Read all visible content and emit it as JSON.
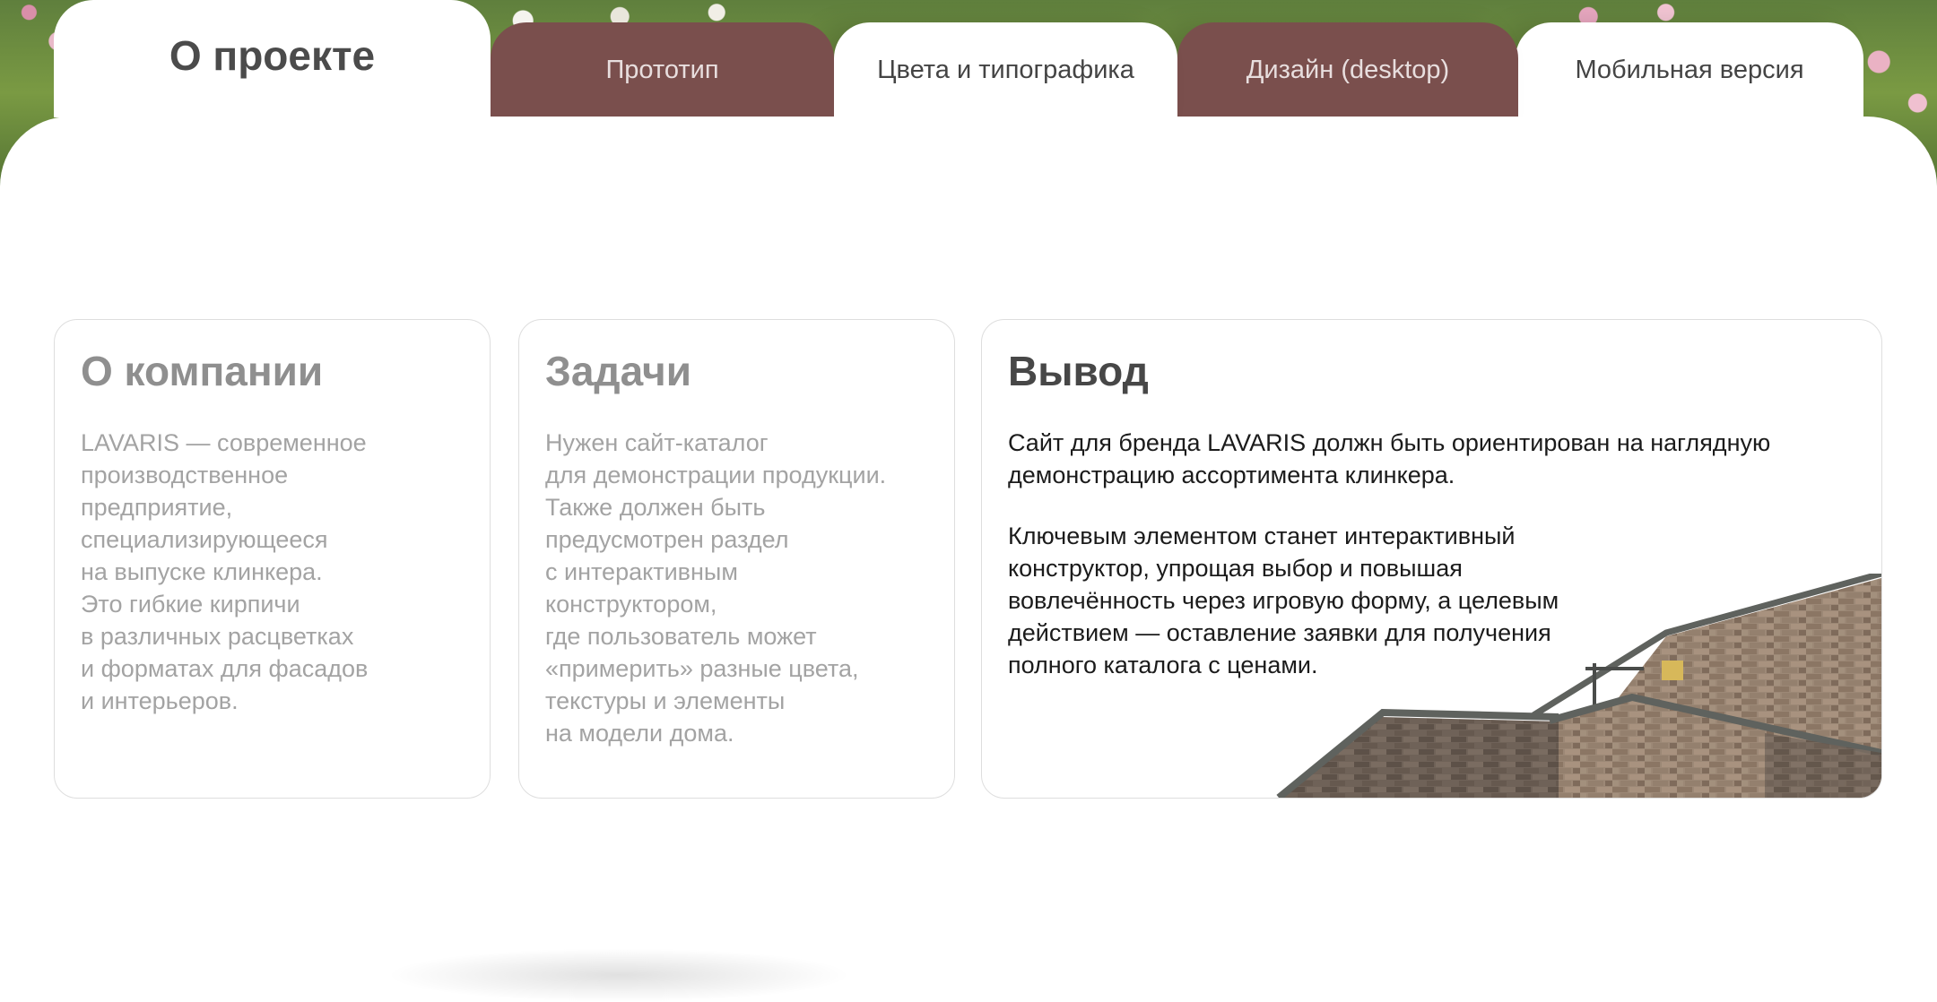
{
  "tabs": [
    {
      "label": "О проекте",
      "active": true
    },
    {
      "label": "Прототип"
    },
    {
      "label": "Цвета и типографика"
    },
    {
      "label": "Дизайн (desktop)"
    },
    {
      "label": "Мобильная версия"
    }
  ],
  "cards": {
    "company": {
      "title": "О компании",
      "text": "LAVARIS — современное\nпроизводственное\nпредприятие,\nспециализирующееся\nна выпуске клинкера.\nЭто гибкие кирпичи\nв различных расцветках\nи форматах для фасадов\nи интерьеров."
    },
    "tasks": {
      "title": "Задачи",
      "text": "Нужен сайт-каталог\nдля демонстрации продукции.\nТакже должен быть\nпредусмотрен раздел\nс интерактивным\nконструктором,\nгде пользователь может\n«примерить» разные цвета,\nтекстуры и элементы\nна модели дома."
    },
    "result": {
      "title": "Вывод",
      "text1": "Сайт для бренда LAVARIS должн быть ориентирован на наглядную\nдемонстрацию ассортимента клинкера.",
      "text2": "Ключевым элементом станет интерактивный\nконструктор, упрощая выбор и повышая\nвовлечённость через игровую форму, а целевым\nдействием — оставление заявки для получения\nполного каталога с ценами."
    }
  },
  "colors": {
    "tab_brown": "#7a4f4d",
    "brick": "#9a8574",
    "roof": "#5f625e"
  }
}
